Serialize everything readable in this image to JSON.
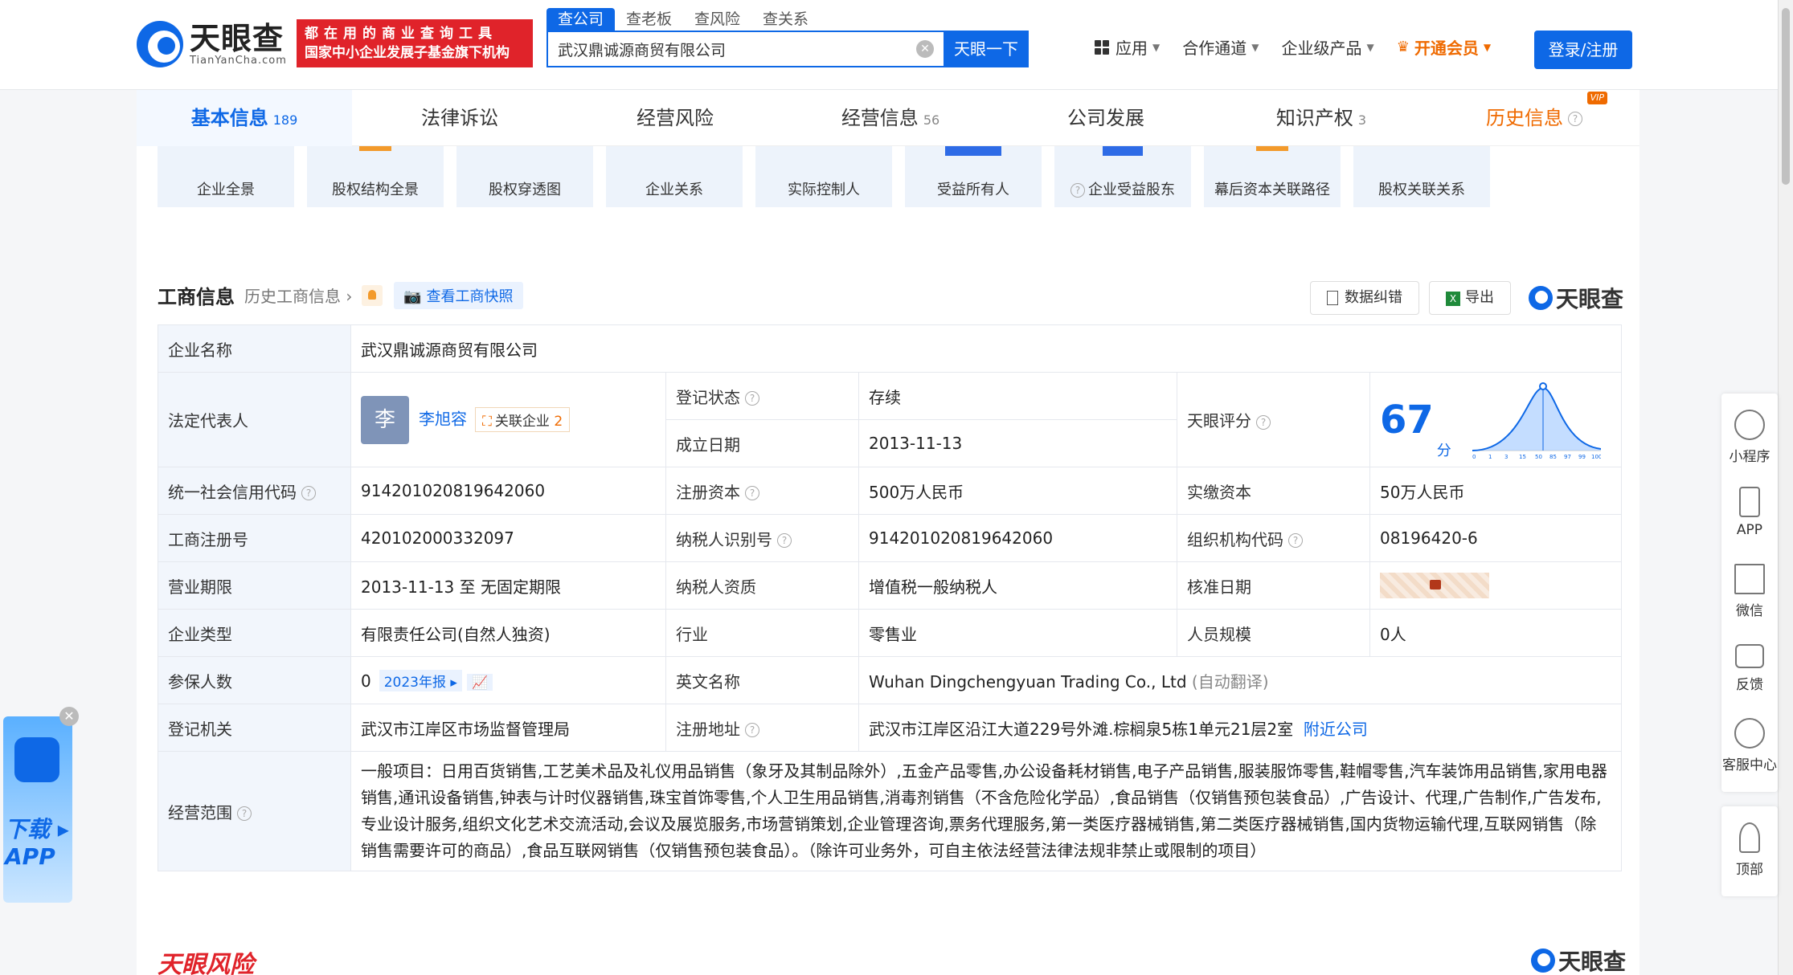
{
  "header": {
    "logo_cn": "天眼查",
    "logo_en": "TianYanCha.com",
    "slogan_line1": "都在用的商业查询工具",
    "slogan_line2": "国家中小企业发展子基金旗下机构",
    "search_tabs": [
      "查公司",
      "查老板",
      "查风险",
      "查关系"
    ],
    "search_value": "武汉鼎诚源商贸有限公司",
    "search_button": "天眼一下",
    "nav": [
      "应用",
      "合作通道",
      "企业级产品",
      "开通会员"
    ],
    "login": "登录/注册"
  },
  "tabs": [
    {
      "label": "基本信息",
      "count": "189"
    },
    {
      "label": "法律诉讼",
      "count": ""
    },
    {
      "label": "经营风险",
      "count": ""
    },
    {
      "label": "经营信息",
      "count": "56"
    },
    {
      "label": "公司发展",
      "count": ""
    },
    {
      "label": "知识产权",
      "count": "3"
    },
    {
      "label": "历史信息",
      "count": ""
    }
  ],
  "vip_badge": "VIP",
  "shortcuts": [
    "企业全景",
    "股权结构全景",
    "股权穿透图",
    "企业关系",
    "实际控制人",
    "受益所有人",
    "企业受益股东",
    "幕后资本关联路径",
    "股权关联关系"
  ],
  "section": {
    "title": "工商信息",
    "history": "历史工商信息",
    "snapshot": "查看工商快照",
    "correct": "数据纠错",
    "export": "导出",
    "watermark": "天眼查"
  },
  "info": {
    "company_name_k": "企业名称",
    "company_name_v": "武汉鼎诚源商贸有限公司",
    "legal_rep_k": "法定代表人",
    "legal_rep_avatar": "李",
    "legal_rep_v": "李旭容",
    "related_k": "关联企业",
    "related_n": "2",
    "reg_status_k": "登记状态",
    "reg_status_v": "存续",
    "est_date_k": "成立日期",
    "est_date_v": "2013-11-13",
    "score_k": "天眼评分",
    "score_v": "67",
    "score_unit": "分",
    "score_ticks": [
      "0",
      "1",
      "3",
      "15",
      "50",
      "85",
      "97",
      "99",
      "100"
    ],
    "credit_code_k": "统一社会信用代码",
    "credit_code_v": "914201020819642060",
    "reg_capital_k": "注册资本",
    "reg_capital_v": "500万人民币",
    "paid_capital_k": "实缴资本",
    "paid_capital_v": "50万人民币",
    "reg_no_k": "工商注册号",
    "reg_no_v": "420102000332097",
    "taxpayer_id_k": "纳税人识别号",
    "taxpayer_id_v": "914201020819642060",
    "org_code_k": "组织机构代码",
    "org_code_v": "08196420-6",
    "term_k": "营业期限",
    "term_v": "2013-11-13 至 无固定期限",
    "taxpayer_q_k": "纳税人资质",
    "taxpayer_q_v": "增值税一般纳税人",
    "approve_k": "核准日期",
    "type_k": "企业类型",
    "type_v": "有限责任公司(自然人独资)",
    "industry_k": "行业",
    "industry_v": "零售业",
    "staff_k": "人员规模",
    "staff_v": "0人",
    "insured_k": "参保人数",
    "insured_v": "0",
    "insured_year": "2023年报",
    "en_name_k": "英文名称",
    "en_name_v": "Wuhan Dingchengyuan Trading Co., Ltd",
    "en_name_note": "(自动翻译)",
    "authority_k": "登记机关",
    "authority_v": "武汉市江岸区市场监督管理局",
    "address_k": "注册地址",
    "address_v": "武汉市江岸区沿江大道229号外滩.棕榈泉5栋1单元21层2室",
    "nearby": "附近公司",
    "scope_k": "经营范围",
    "scope_v": "一般项目：日用百货销售,工艺美术品及礼仪用品销售（象牙及其制品除外）,五金产品零售,办公设备耗材销售,电子产品销售,服装服饰零售,鞋帽零售,汽车装饰用品销售,家用电器销售,通讯设备销售,钟表与计时仪器销售,珠宝首饰零售,个人卫生用品销售,消毒剂销售（不含危险化学品）,食品销售（仅销售预包装食品）,广告设计、代理,广告制作,广告发布,专业设计服务,组织文化艺术交流活动,会议及展览服务,市场营销策划,企业管理咨询,票务代理服务,第一类医疗器械销售,第二类医疗器械销售,国内货物运输代理,互联网销售（除销售需要许可的商品）,食品互联网销售（仅销售预包装食品）。（除许可业务外，可自主依法经营法律法规非禁止或限制的项目）"
  },
  "side": [
    "小程序",
    "APP",
    "微信",
    "反馈",
    "客服中心",
    "顶部"
  ],
  "app_download": "下载 ▸ APP",
  "risk_title": "天眼风险"
}
